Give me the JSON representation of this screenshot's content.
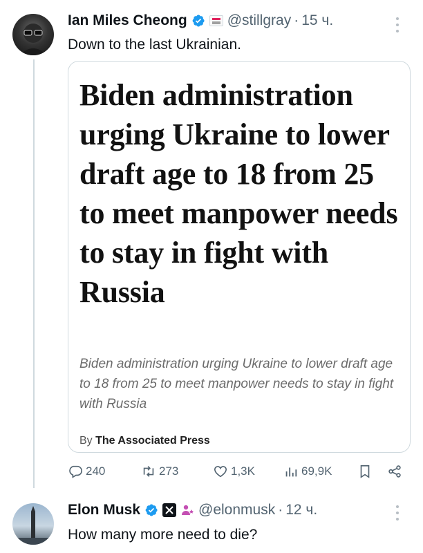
{
  "tweet1": {
    "author_name": "Ian Miles Cheong",
    "handle": "@stillgray",
    "separator": "·",
    "time": "15 ч.",
    "text": "Down to the last Ukrainian.",
    "card": {
      "headline": "Biden administration urging Ukraine to lower draft age to 18 from 25 to meet manpower needs to stay in fight with Russia",
      "description": "Biden administration urging Ukraine to lower draft age to 18 from 25 to meet manpower needs to stay in fight with Russia",
      "byline_prefix": "By",
      "byline_source": "The Associated Press"
    },
    "actions": {
      "replies": "240",
      "reposts": "273",
      "likes": "1,3K",
      "views": "69,9K"
    }
  },
  "tweet2": {
    "author_name": "Elon Musk",
    "handle": "@elonmusk",
    "separator": "·",
    "time": "12 ч.",
    "text": "How many more need to die?"
  },
  "icons": {
    "verified": "verified-badge-icon",
    "affiliation": "affiliation-badge-icon",
    "x_logo": "x-logo-icon",
    "reply": "reply-icon",
    "repost": "repost-icon",
    "like": "heart-icon",
    "views": "views-icon",
    "bookmark": "bookmark-icon",
    "share": "share-icon",
    "more": "more-icon"
  },
  "colors": {
    "verified_blue": "#1d9bf0",
    "secondary_text": "#536471",
    "border": "#cfd9de"
  }
}
